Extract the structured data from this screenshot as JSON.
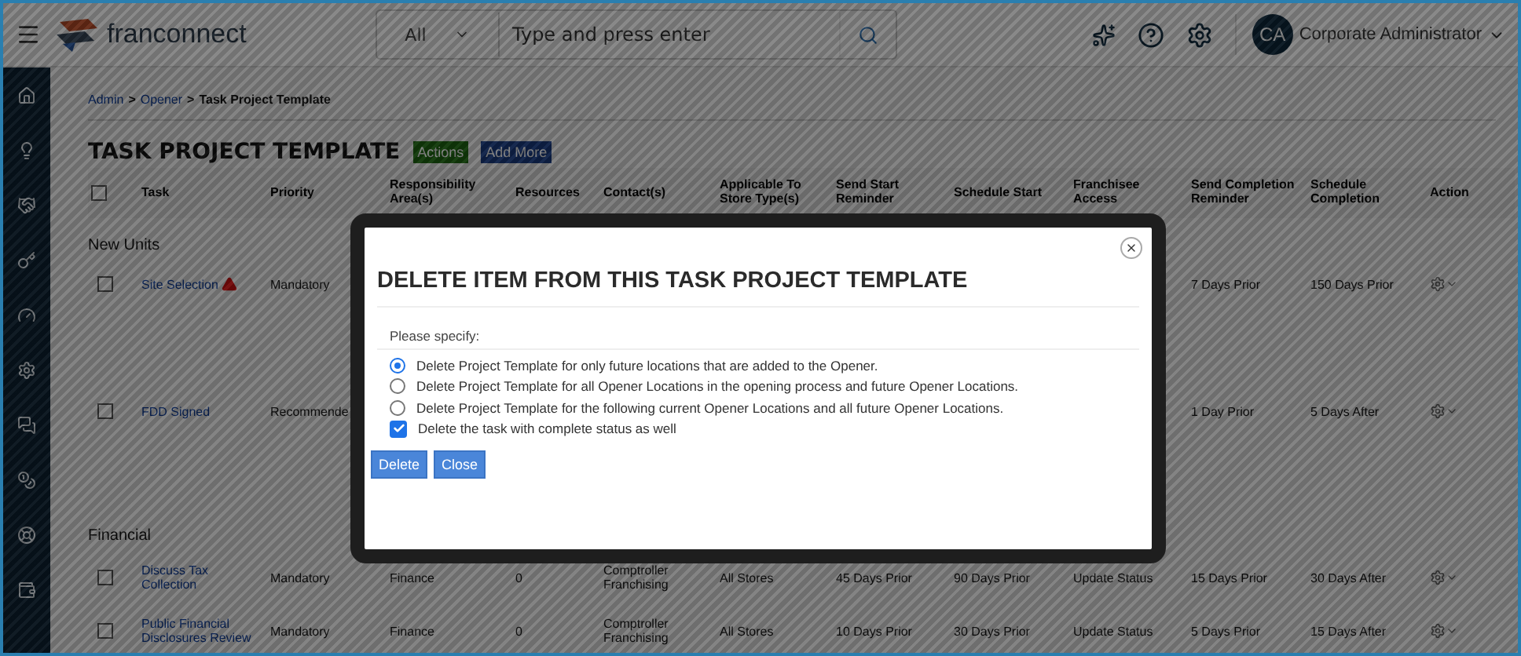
{
  "header": {
    "logo": "franconnect",
    "search": {
      "scope": "All",
      "placeholder": "Type and press enter"
    },
    "user": {
      "initials": "CA",
      "name": "Corporate Administrator"
    }
  },
  "breadcrumb": {
    "separator": ">",
    "items": [
      {
        "label": "Admin",
        "link": true
      },
      {
        "label": "Opener",
        "link": true
      },
      {
        "label": "Task Project Template",
        "link": false
      }
    ]
  },
  "page_title": "TASK PROJECT TEMPLATE",
  "title_buttons": [
    {
      "label": "Actions",
      "kind": "green"
    },
    {
      "label": "Add More",
      "kind": "blue"
    }
  ],
  "table": {
    "select_all_checked": false,
    "columns": [
      "Task",
      "Priority",
      "Responsibility Area(s)",
      "Resources",
      "Contact(s)",
      "Applicable To Store Type(s)",
      "Send Start Reminder",
      "Schedule Start",
      "Franchisee Access",
      "Send Completion Reminder",
      "Schedule Completion",
      "Action"
    ],
    "groups": [
      {
        "name": "New Units",
        "rows": [
          {
            "task": "Site Selection",
            "warning": true,
            "checked": false,
            "cells": [
              "Mandatory",
              "",
              "",
              "",
              "",
              "",
              "",
              "",
              "7 Days Prior",
              "150 Days Prior"
            ]
          },
          {
            "task": "FDD Signed",
            "warning": false,
            "checked": false,
            "cells": [
              "Recommende",
              "",
              "",
              "",
              "",
              "",
              "",
              "",
              "1 Day Prior",
              "5 Days After"
            ]
          }
        ]
      },
      {
        "name": "Financial",
        "rows": [
          {
            "task": "Discuss Tax Collection",
            "warning": false,
            "checked": false,
            "cells": [
              "Mandatory",
              "Finance",
              "0",
              "Comptroller Franchising",
              "All Stores",
              "45 Days Prior",
              "90 Days Prior",
              "Update Status",
              "15 Days Prior",
              "30 Days After"
            ]
          },
          {
            "task": "Public Financial Disclosures Review",
            "warning": false,
            "checked": false,
            "cells": [
              "Mandatory",
              "Finance",
              "0",
              "Comptroller Franchising",
              "All Stores",
              "10 Days Prior",
              "30 Days Prior",
              "Update Status",
              "5 Days Prior",
              "15 Days After"
            ]
          }
        ]
      }
    ]
  },
  "dialog": {
    "title": "DELETE ITEM FROM THIS TASK PROJECT TEMPLATE",
    "prompt": "Please specify:",
    "options": [
      {
        "label": "Delete Project Template for only future locations that are added to the Opener.",
        "selected": true
      },
      {
        "label": "Delete Project Template for all Opener Locations in the opening process and future Opener Locations.",
        "selected": false
      },
      {
        "label": "Delete Project Template for the following current Opener Locations and all future Opener Locations.",
        "selected": false
      }
    ],
    "checkbox": {
      "label": "Delete the task with complete status as well",
      "checked": true
    },
    "buttons": [
      "Delete",
      "Close"
    ]
  }
}
